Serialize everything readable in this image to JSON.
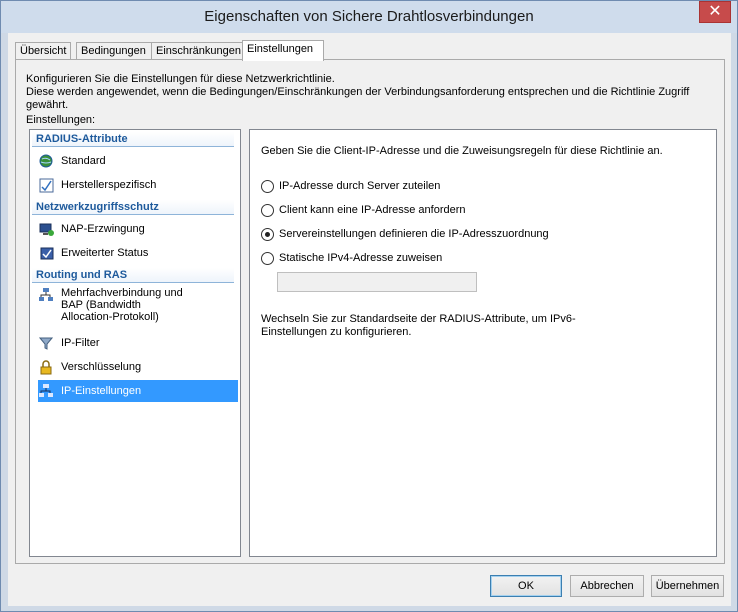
{
  "window": {
    "title": "Eigenschaften von Sichere Drahtlosverbindungen",
    "close_glyph": "✕"
  },
  "tabs": [
    {
      "label": "Übersicht"
    },
    {
      "label": "Bedingungen"
    },
    {
      "label": "Einschränkungen"
    },
    {
      "label": "Einstellungen",
      "active": true
    }
  ],
  "description": {
    "line1": "Konfigurieren Sie die Einstellungen für diese Netzwerkrichtlinie.",
    "line2": "Diese werden angewendet, wenn die Bedingungen/Einschränkungen der Verbindungsanforderung entsprechen und die Richtlinie Zugriff gewährt."
  },
  "settings_label": "Einstellungen:",
  "nav": {
    "sections": [
      {
        "header": "RADIUS-Attribute",
        "items": [
          {
            "label": "Standard",
            "icon": "globe-icon"
          },
          {
            "label": "Herstellerspezifisch",
            "icon": "vendor-icon"
          }
        ]
      },
      {
        "header": "Netzwerkzugriffsschutz",
        "items": [
          {
            "label": "NAP-Erzwingung",
            "icon": "nap-icon"
          },
          {
            "label": "Erweiterter Status",
            "icon": "status-icon"
          }
        ]
      },
      {
        "header": "Routing und RAS",
        "items": [
          {
            "label": "Mehrfachverbindung und BAP (Bandwidth Allocation-Protokoll)",
            "icon": "network-icon"
          },
          {
            "label": "IP-Filter",
            "icon": "filter-icon"
          },
          {
            "label": "Verschlüsselung",
            "icon": "lock-icon"
          },
          {
            "label": "IP-Einstellungen",
            "icon": "network-icon",
            "selected": true
          }
        ]
      }
    ]
  },
  "content": {
    "intro": "Geben Sie die Client-IP-Adresse und die Zuweisungsregeln für diese Richtlinie an.",
    "options": [
      {
        "label": "IP-Adresse durch Server zuteilen",
        "checked": false
      },
      {
        "label": "Client kann eine IP-Adresse anfordern",
        "checked": false
      },
      {
        "label": "Servereinstellungen definieren die IP-Adresszuordnung",
        "checked": true
      },
      {
        "label": "Statische IPv4-Adresse zuweisen",
        "checked": false
      }
    ],
    "static_ip_value": "",
    "note": "Wechseln Sie zur Standardseite der RADIUS-Attribute, um IPv6-Einstellungen zu konfigurieren."
  },
  "buttons": {
    "ok": "OK",
    "cancel": "Abbrechen",
    "apply": "Übernehmen"
  }
}
